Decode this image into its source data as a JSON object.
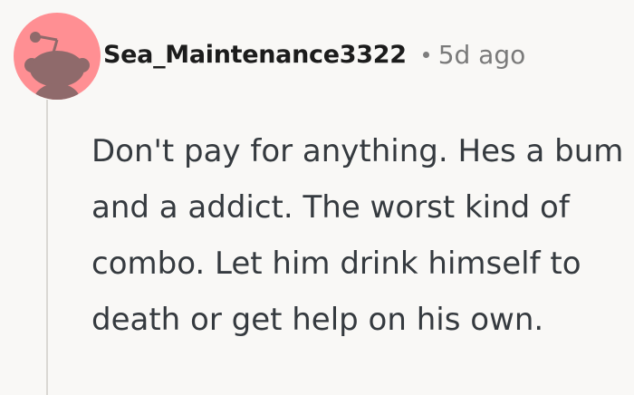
{
  "comment": {
    "author": "Sea_Maintenance3322",
    "separator_icon": "dot-separator",
    "timestamp": "5d ago",
    "body": "Don't pay for anything. Hes a bum and a addict. The worst kind of combo. Let him drink himself to death or get help on his own.",
    "avatar_icon": "reddit-snoo-avatar"
  },
  "colors": {
    "avatar_background": "#ff8f93",
    "snoo_fill": "#8f6a6b",
    "page_background": "#f9f8f6",
    "body_text": "#353a3f"
  }
}
